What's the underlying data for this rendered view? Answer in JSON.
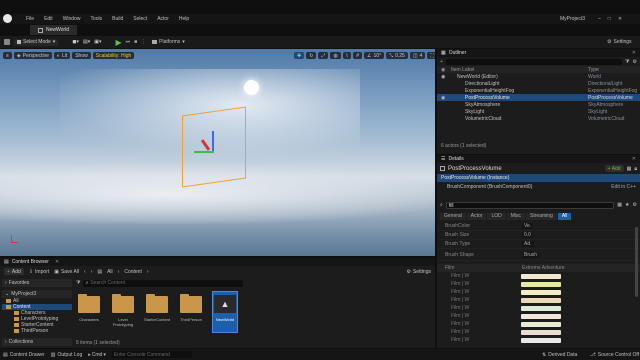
{
  "menubar": {
    "menus": [
      "File",
      "Edit",
      "Window",
      "Tools",
      "Build",
      "Select",
      "Actor",
      "Help"
    ],
    "project": "MyProject3"
  },
  "level_tab": {
    "label": "NewWorld"
  },
  "toolbar": {
    "select_mode": "Select Mode",
    "platforms": "Platforms",
    "settings": "Settings"
  },
  "viewport": {
    "perspective": "Perspective",
    "lit": "Lit",
    "show": "Show",
    "scalability": "Scalability: High",
    "snap_angle": "10°",
    "scale_val": "0.25",
    "cam_speed": "4"
  },
  "outliner": {
    "title": "Outliner",
    "col_label": "Item Label",
    "col_type": "Type",
    "items": [
      {
        "label": "NewWorld (Editor)",
        "type": "World"
      },
      {
        "label": "DirectionalLight",
        "type": "DirectionalLight"
      },
      {
        "label": "ExponentialHeightFog",
        "type": "ExponentialHeightFog"
      },
      {
        "label": "PostProcessVolume",
        "type": "PostProcessVolume"
      },
      {
        "label": "SkyAtmosphere",
        "type": "SkyAtmosphere"
      },
      {
        "label": "SkyLight",
        "type": "SkyLight"
      },
      {
        "label": "VolumetricCloud",
        "type": "VolumetricCloud"
      }
    ],
    "status": "6 actors (1 selected)"
  },
  "details": {
    "title": "Details",
    "object": "PostProcessVolume",
    "add": "+ Add",
    "instance": "PostProcessVolume (Instance)",
    "component": "BrushComponent (BrushComponent0)",
    "edit_cpp": "Edit in C++",
    "search_value": "fill",
    "filters": [
      "General",
      "Actor",
      "LOD",
      "Misc",
      "Streaming",
      "All"
    ],
    "props": [
      {
        "label": "BrushColor",
        "value": "Ve."
      },
      {
        "label": "Brush Size",
        "value": "0.0"
      },
      {
        "label": "Brush Type",
        "value": "Ad."
      },
      {
        "label": "Brush Shape",
        "value": "Brush"
      }
    ],
    "section": "Film",
    "section_value": "Extreme Adventure",
    "sub_rows": [
      "Film | W",
      "Film | W",
      "Film | W",
      "Film | W",
      "Film | W",
      "Film | W",
      "Film | W",
      "Film | W",
      "Film | W"
    ],
    "swatch_colors": [
      "#f2ead0",
      "#e6e8a8",
      "#f4eec4",
      "#ecd8b4",
      "#dcebd4",
      "#f0e8d8",
      "#e8ecd0",
      "#eadcd2",
      "#e8e8e8"
    ]
  },
  "content_browser": {
    "title": "Content Browser",
    "add": "Add",
    "import": "Import",
    "save_all": "Save All",
    "path": [
      "All",
      "Content"
    ],
    "settings": "Settings",
    "search": "Search Content",
    "tree_header": "Favorites",
    "project": "MyProject3",
    "tree": [
      "All",
      "Content",
      "Characters",
      "LevelPrototyping",
      "StarterContent",
      "ThirdPerson"
    ],
    "collections": "Collections",
    "assets": [
      {
        "label": "Characters"
      },
      {
        "label": "Level Prototyping"
      },
      {
        "label": "StarterContent"
      },
      {
        "label": "ThirdPerson"
      },
      {
        "label": "NewWorld"
      }
    ],
    "status": "5 items (1 selected)"
  },
  "statusbar": {
    "content_drawer": "Content Drawer",
    "output_log": "Output Log",
    "cmd": "Cmd",
    "cmd_placeholder": "Enter Console Command",
    "derived": "Derived Data",
    "source": "Source Control Off"
  },
  "colors": {
    "accent": "#1d4a7a",
    "play": "#5fbf3f",
    "scalability": "#f0c040",
    "folder": "#c9974a"
  }
}
